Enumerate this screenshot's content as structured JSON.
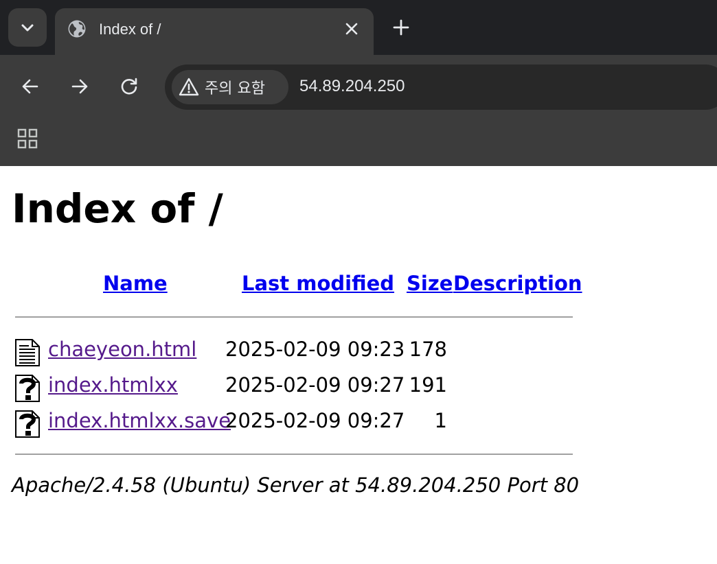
{
  "browser": {
    "tab": {
      "title": "Index of /"
    },
    "address_bar": {
      "security_label": "주의 요함",
      "url": "54.89.204.250"
    },
    "icons": [
      "tab-search-icon",
      "globe-icon",
      "close-icon",
      "plus-icon",
      "back-arrow-icon",
      "forward-arrow-icon",
      "reload-icon",
      "warning-icon",
      "apps-grid-icon"
    ]
  },
  "page": {
    "heading": "Index of /",
    "columns": {
      "name": "Name",
      "last_modified": "Last modified",
      "size": "Size",
      "description": "Description"
    },
    "files": [
      {
        "icon": "text-file-icon",
        "name": "chaeyeon.html",
        "modified": "2025-02-09 09:23",
        "size": "178"
      },
      {
        "icon": "unknown-file-icon",
        "name": "index.htmlxx",
        "modified": "2025-02-09 09:27",
        "size": "191"
      },
      {
        "icon": "unknown-file-icon",
        "name": "index.htmlxx.save",
        "modified": "2025-02-09 09:27",
        "size": "1"
      }
    ],
    "server_signature": "Apache/2.4.58 (Ubuntu) Server at 54.89.204.250 Port 80"
  },
  "colors": {
    "chrome_dark": "#202124",
    "chrome_toolbar": "#3c3c3c",
    "link": "#0000ee",
    "visited_link": "#551a8b"
  }
}
